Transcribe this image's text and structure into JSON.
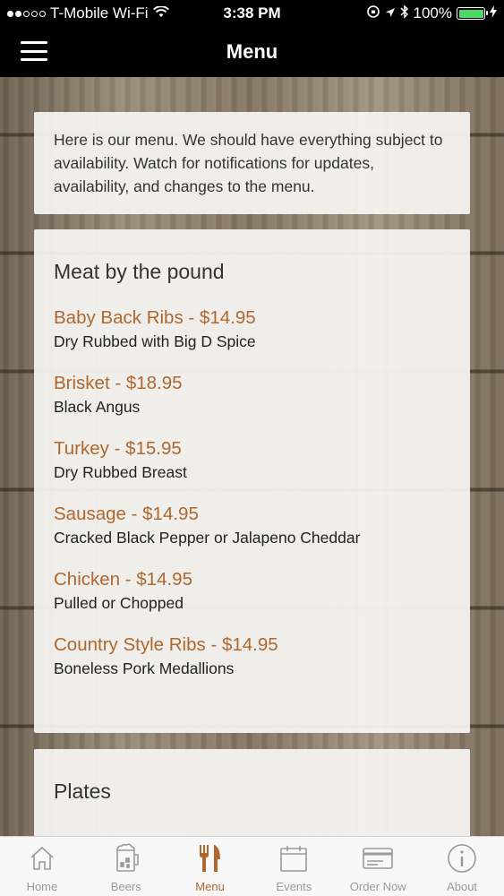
{
  "status_bar": {
    "carrier": "T-Mobile Wi-Fi",
    "time": "3:38 PM",
    "battery": "100%",
    "battery_color": "#4cd964"
  },
  "nav": {
    "title": "Menu"
  },
  "intro": {
    "text": "Here is our menu. We should have everything subject to availability. Watch for notifications for updates, availability, and changes to the menu."
  },
  "sections": [
    {
      "title": "Meat by the pound",
      "items": [
        {
          "name": "Baby Back Ribs - $14.95",
          "desc": "Dry Rubbed with Big D Spice"
        },
        {
          "name": "Brisket - $18.95",
          "desc": "Black Angus"
        },
        {
          "name": "Turkey - $15.95",
          "desc": "Dry Rubbed Breast"
        },
        {
          "name": "Sausage - $14.95",
          "desc": "Cracked Black Pepper or Jalapeno Cheddar"
        },
        {
          "name": "Chicken - $14.95",
          "desc": "Pulled or Chopped"
        },
        {
          "name": "Country Style Ribs - $14.95",
          "desc": "Boneless Pork Medallions"
        }
      ]
    },
    {
      "title": "Plates"
    }
  ],
  "tabs": [
    {
      "label": "Home",
      "icon": "home-icon"
    },
    {
      "label": "Beers",
      "icon": "beer-mug-icon"
    },
    {
      "label": "Menu",
      "icon": "fork-knife-icon",
      "active": true
    },
    {
      "label": "Events",
      "icon": "calendar-icon"
    },
    {
      "label": "Order Now",
      "icon": "credit-card-icon"
    },
    {
      "label": "About",
      "icon": "info-icon"
    }
  ],
  "colors": {
    "accent": "#b0672e",
    "nav_bg": "#000000",
    "tab_inactive": "#999999"
  }
}
